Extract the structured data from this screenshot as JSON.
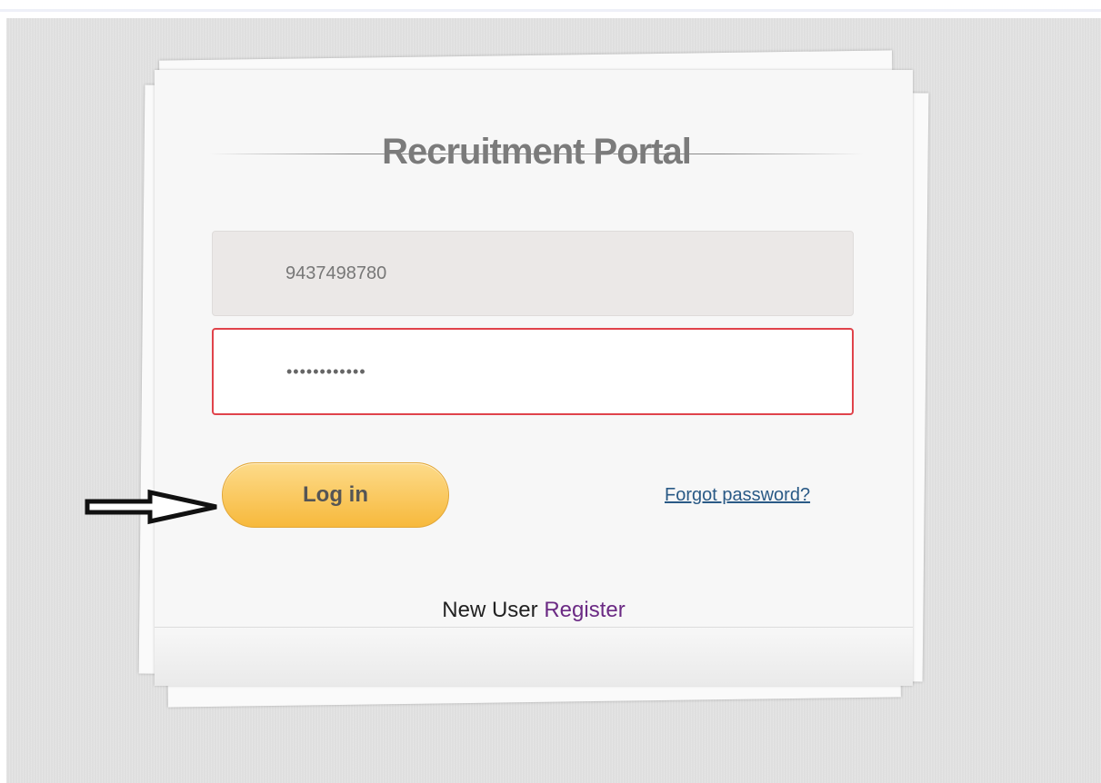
{
  "portal": {
    "title": "Recruitment Portal"
  },
  "login_form": {
    "username_value": "9437498780",
    "password_value": "••••••••••••",
    "login_label": "Log in",
    "forgot_label": "Forgot password?",
    "new_user_text": "New User ",
    "register_label": "Register"
  },
  "colors": {
    "error_border": "#e0434b",
    "button_gradient_top": "#fddb8a",
    "button_gradient_bottom": "#f7b93c",
    "link": "#2a5a86",
    "register_link": "#6b2a84"
  },
  "icons": {
    "annotation": "arrow-right-icon"
  }
}
